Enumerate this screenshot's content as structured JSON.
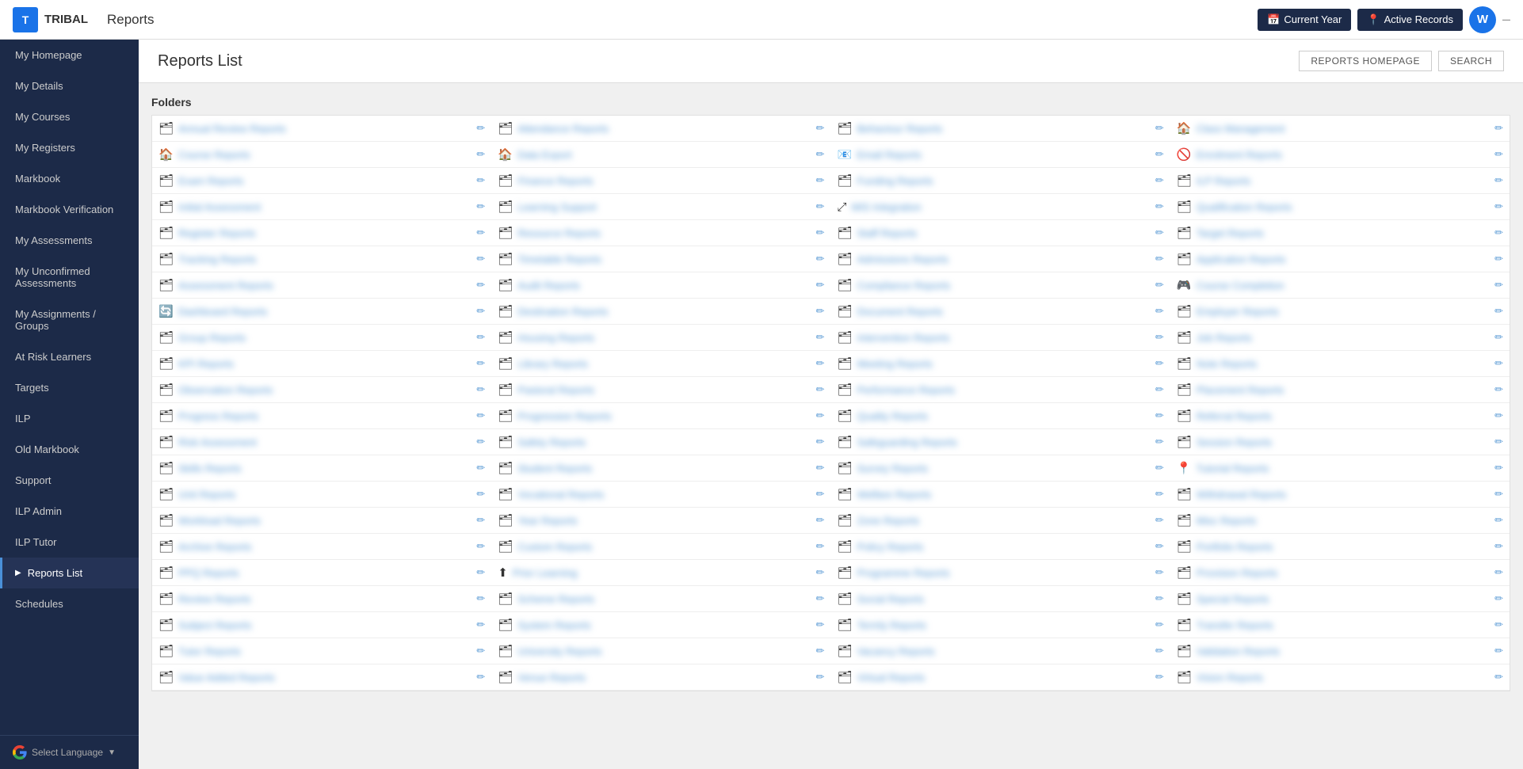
{
  "topbar": {
    "logo_letter": "T",
    "app_name": "TRIBAL",
    "page_title": "Reports",
    "btn_current_year": "Current Year",
    "btn_active_records": "Active Records",
    "user_initial": "W",
    "calendar_icon": "📅",
    "pin_icon": "📍"
  },
  "sidebar": {
    "items": [
      {
        "label": "My Homepage",
        "active": false
      },
      {
        "label": "My Details",
        "active": false
      },
      {
        "label": "My Courses",
        "active": false
      },
      {
        "label": "My Registers",
        "active": false
      },
      {
        "label": "Markbook",
        "active": false
      },
      {
        "label": "Markbook Verification",
        "active": false
      },
      {
        "label": "My Assessments",
        "active": false
      },
      {
        "label": "My Unconfirmed Assessments",
        "active": false
      },
      {
        "label": "My Assignments / Groups",
        "active": false
      },
      {
        "label": "At Risk Learners",
        "active": false
      },
      {
        "label": "Targets",
        "active": false
      },
      {
        "label": "ILP",
        "active": false
      },
      {
        "label": "Old Markbook",
        "active": false
      },
      {
        "label": "Support",
        "active": false
      },
      {
        "label": "ILP Admin",
        "active": false
      },
      {
        "label": "ILP Tutor",
        "active": false
      },
      {
        "label": "Reports List",
        "active": true
      },
      {
        "label": "Schedules",
        "active": false
      }
    ],
    "select_language": "Select Language"
  },
  "main": {
    "page_title": "Reports List",
    "btn_reports_homepage": "REPORTS HOMEPAGE",
    "btn_search": "SEARCH",
    "folders_label": "Folders",
    "folders": [
      {
        "icon": "folder",
        "name": "Annual Review Reports"
      },
      {
        "icon": "folder",
        "name": "Attendance Reports"
      },
      {
        "icon": "folder",
        "name": "Behaviour Reports"
      },
      {
        "icon": "home",
        "name": "Class Management"
      },
      {
        "icon": "home",
        "name": "Course Reports"
      },
      {
        "icon": "home",
        "name": "Data Export"
      },
      {
        "icon": "mail",
        "name": "Email Reports"
      },
      {
        "icon": "block",
        "name": "Enrolment Reports"
      },
      {
        "icon": "folder",
        "name": "Exam Reports"
      },
      {
        "icon": "folder",
        "name": "Finance Reports"
      },
      {
        "icon": "folder",
        "name": "Funding Reports"
      },
      {
        "icon": "folder",
        "name": "ILP Reports"
      },
      {
        "icon": "folder",
        "name": "Initial Assessment"
      },
      {
        "icon": "folder",
        "name": "Learning Support"
      },
      {
        "icon": "move",
        "name": "MIS Integration"
      },
      {
        "icon": "folder",
        "name": "Qualification Reports"
      },
      {
        "icon": "folder",
        "name": "Register Reports"
      },
      {
        "icon": "folder",
        "name": "Resource Reports"
      },
      {
        "icon": "folder",
        "name": "Staff Reports"
      },
      {
        "icon": "folder",
        "name": "Target Reports"
      },
      {
        "icon": "folder",
        "name": "Tracking Reports"
      },
      {
        "icon": "folder",
        "name": "Timetable Reports"
      },
      {
        "icon": "folder",
        "name": "Admissions Reports"
      },
      {
        "icon": "folder",
        "name": "Application Reports"
      },
      {
        "icon": "folder",
        "name": "Assessment Reports"
      },
      {
        "icon": "folder",
        "name": "Audit Reports"
      },
      {
        "icon": "folder",
        "name": "Compliance Reports"
      },
      {
        "icon": "gamepad",
        "name": "Course Completion"
      },
      {
        "icon": "refresh",
        "name": "Dashboard Reports"
      },
      {
        "icon": "folder",
        "name": "Destination Reports"
      },
      {
        "icon": "folder",
        "name": "Document Reports"
      },
      {
        "icon": "folder",
        "name": "Employer Reports"
      },
      {
        "icon": "folder",
        "name": "Group Reports"
      },
      {
        "icon": "folder",
        "name": "Housing Reports"
      },
      {
        "icon": "folder",
        "name": "Intervention Reports"
      },
      {
        "icon": "folder",
        "name": "Job Reports"
      },
      {
        "icon": "folder",
        "name": "KPI Reports"
      },
      {
        "icon": "folder",
        "name": "Library Reports"
      },
      {
        "icon": "folder",
        "name": "Meeting Reports"
      },
      {
        "icon": "folder",
        "name": "Note Reports"
      },
      {
        "icon": "folder",
        "name": "Observation Reports"
      },
      {
        "icon": "folder",
        "name": "Pastoral Reports"
      },
      {
        "icon": "folder",
        "name": "Performance Reports"
      },
      {
        "icon": "folder",
        "name": "Placement Reports"
      },
      {
        "icon": "folder",
        "name": "Progress Reports"
      },
      {
        "icon": "folder",
        "name": "Progression Reports"
      },
      {
        "icon": "folder",
        "name": "Quality Reports"
      },
      {
        "icon": "folder",
        "name": "Referral Reports"
      },
      {
        "icon": "folder",
        "name": "Risk Assessment"
      },
      {
        "icon": "folder",
        "name": "Safety Reports"
      },
      {
        "icon": "folder",
        "name": "Safeguarding Reports"
      },
      {
        "icon": "folder",
        "name": "Session Reports"
      },
      {
        "icon": "folder",
        "name": "Skills Reports"
      },
      {
        "icon": "folder",
        "name": "Student Reports"
      },
      {
        "icon": "folder",
        "name": "Survey Reports"
      },
      {
        "icon": "location",
        "name": "Tutorial Reports"
      },
      {
        "icon": "folder",
        "name": "Unit Reports"
      },
      {
        "icon": "folder",
        "name": "Vocational Reports"
      },
      {
        "icon": "folder",
        "name": "Welfare Reports"
      },
      {
        "icon": "folder",
        "name": "Withdrawal Reports"
      },
      {
        "icon": "folder",
        "name": "Workload Reports"
      },
      {
        "icon": "folder",
        "name": "Year Reports"
      },
      {
        "icon": "folder",
        "name": "Zone Reports"
      },
      {
        "icon": "folder",
        "name": "Misc Reports"
      },
      {
        "icon": "folder",
        "name": "Archive Reports"
      },
      {
        "icon": "folder",
        "name": "Custom Reports"
      },
      {
        "icon": "folder",
        "name": "Policy Reports"
      },
      {
        "icon": "folder",
        "name": "Portfolio Reports"
      },
      {
        "icon": "folder",
        "name": "PPQ Reports"
      },
      {
        "icon": "upload",
        "name": "Prior Learning"
      },
      {
        "icon": "folder",
        "name": "Programme Reports"
      },
      {
        "icon": "folder",
        "name": "Provision Reports"
      },
      {
        "icon": "folder",
        "name": "Review Reports"
      },
      {
        "icon": "folder",
        "name": "Scheme Reports"
      },
      {
        "icon": "folder",
        "name": "Social Reports"
      },
      {
        "icon": "folder",
        "name": "Special Reports"
      },
      {
        "icon": "folder",
        "name": "Subject Reports"
      },
      {
        "icon": "folder",
        "name": "System Reports"
      },
      {
        "icon": "folder",
        "name": "Termly Reports"
      },
      {
        "icon": "folder",
        "name": "Transfer Reports"
      },
      {
        "icon": "folder",
        "name": "Tutor Reports"
      },
      {
        "icon": "folder",
        "name": "University Reports"
      },
      {
        "icon": "folder",
        "name": "Vacancy Reports"
      },
      {
        "icon": "folder",
        "name": "Validation Reports"
      },
      {
        "icon": "folder",
        "name": "Value Added Reports"
      },
      {
        "icon": "folder",
        "name": "Venue Reports"
      },
      {
        "icon": "folder",
        "name": "Virtual Reports"
      },
      {
        "icon": "folder",
        "name": "Vision Reports"
      }
    ]
  }
}
